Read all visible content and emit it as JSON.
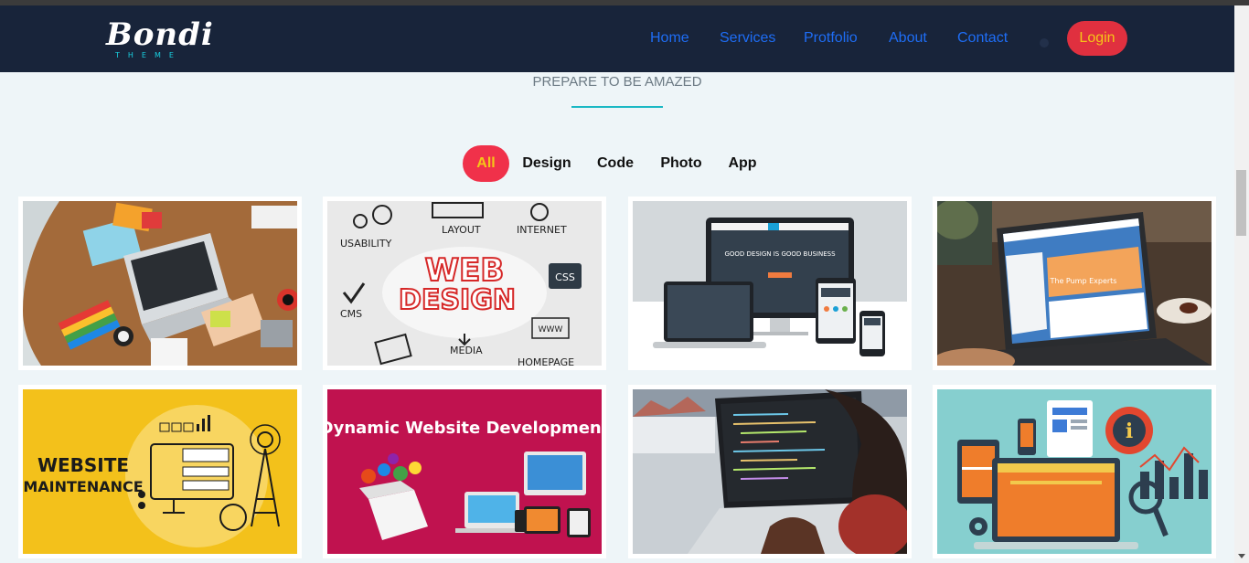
{
  "brand": {
    "logo_text": "Bondi",
    "logo_sub": "THEME"
  },
  "nav": {
    "items": [
      {
        "label": "Home"
      },
      {
        "label": "Services"
      },
      {
        "label": "Protfolio"
      },
      {
        "label": "About"
      },
      {
        "label": "Contact"
      }
    ],
    "login_label": "Login"
  },
  "portfolio": {
    "tagline": "PREPARE TO BE AMAZED",
    "filters": [
      {
        "label": "All",
        "active": true
      },
      {
        "label": "Design",
        "active": false
      },
      {
        "label": "Code",
        "active": false
      },
      {
        "label": "Photo",
        "active": false
      },
      {
        "label": "App",
        "active": false
      }
    ],
    "items": [
      {
        "image": "workspace-desk-laptop-photo"
      },
      {
        "image": "web-design-concept",
        "words": {
          "title_1": "WEB",
          "title_2": "DESIGN",
          "usability": "USABILITY",
          "layout": "LAYOUT",
          "internet": "INTERNET",
          "css": "CSS",
          "cms": "CMS",
          "media": "MEDIA",
          "www": "WWW",
          "homepage": "HOMEPAGE"
        }
      },
      {
        "image": "responsive-devices-mockup",
        "words": {
          "headline": "GOOD DESIGN IS GOOD BUSINESS"
        }
      },
      {
        "image": "laptop-website-photo",
        "words": {
          "headline": "The Pump Experts"
        }
      },
      {
        "image": "website-maintenance-illustration",
        "words": {
          "line_1": "WEBSITE",
          "line_2": "MAINTENANCE"
        }
      },
      {
        "image": "dynamic-website-development-banner",
        "words": {
          "title": "Dynamic Website Development"
        }
      },
      {
        "image": "coding-on-laptop-photo"
      },
      {
        "image": "analytics-devices-illustration"
      }
    ]
  },
  "colors": {
    "navbar_bg": "#18243a",
    "nav_link": "#1e6df5",
    "accent_red": "#e0303f",
    "accent_yellow": "#f5c518",
    "teal": "#1ab8c4",
    "page_bg": "#eef5f8"
  }
}
